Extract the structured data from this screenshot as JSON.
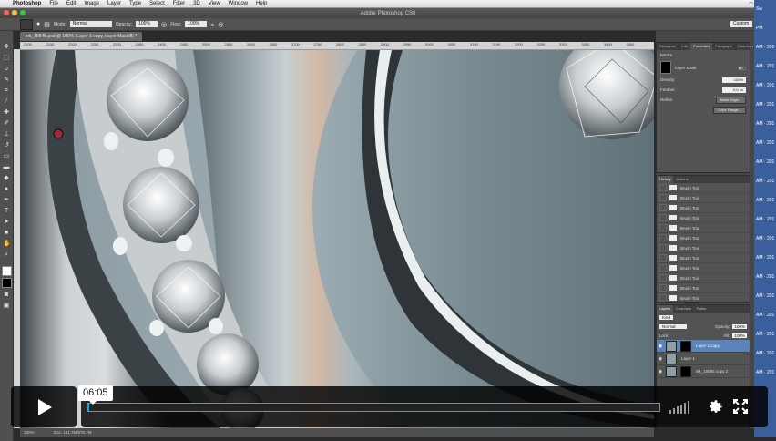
{
  "mac_menubar": {
    "items": [
      "Photoshop",
      "File",
      "Edit",
      "Image",
      "Layer",
      "Type",
      "Select",
      "Filter",
      "3D",
      "View",
      "Window",
      "Help"
    ]
  },
  "ps_window": {
    "title": "Adobe Photoshop CS6",
    "doc_tab": "ink_15845.psd @ 100% (Layer 1 copy, Layer Mask/8) *"
  },
  "options_bar": {
    "mode_label": "Mode:",
    "mode_value": "Normal",
    "opacity_label": "Opacity:",
    "opacity_value": "100%",
    "flow_label": "Flow:",
    "flow_value": "100%",
    "workspace_value": "Custom"
  },
  "ruler_ticks": [
    "2100",
    "2150",
    "2200",
    "2250",
    "2300",
    "2350",
    "2400",
    "2450",
    "2500",
    "2550",
    "2600",
    "2650",
    "2700",
    "2750",
    "2800",
    "2850",
    "2900",
    "2950",
    "3000",
    "3050",
    "3100",
    "3150",
    "3200",
    "3250",
    "3300",
    "3350",
    "3400",
    "3450"
  ],
  "properties_panel": {
    "tabs": [
      "Histogram",
      "Info",
      "Properties",
      "Paragraph",
      "Character"
    ],
    "header": "Masks",
    "mask_label": "Layer Mask",
    "density_label": "Density:",
    "density_value": "100%",
    "feather_label": "Feather:",
    "feather_value": "0.0 px",
    "refine_label": "Refine:",
    "mask_edge_button": "Mask Edge...",
    "color_range_button": "Color Range..."
  },
  "history_panel": {
    "tabs": [
      "History",
      "Actions"
    ],
    "items": [
      "Brush Tool",
      "Brush Tool",
      "Brush Tool",
      "Brush Tool",
      "Brush Tool",
      "Brush Tool",
      "Brush Tool",
      "Brush Tool",
      "Brush Tool",
      "Brush Tool",
      "Brush Tool",
      "Brush Tool",
      "Brush Tool"
    ]
  },
  "layers_panel": {
    "tabs": [
      "Layers",
      "Channels",
      "Paths"
    ],
    "kind_label": "Kind",
    "blend_value": "Normal",
    "opacity_label": "Opacity:",
    "opacity_value": "100%",
    "lock_label": "Lock:",
    "fill_label": "Fill:",
    "fill_value": "100%",
    "layers": [
      {
        "name": "Layer 1 copy",
        "selected": true,
        "has_mask": true
      },
      {
        "name": "Layer 1",
        "selected": false,
        "has_mask": false
      },
      {
        "name": "ink_15594 copy 2",
        "selected": false,
        "has_mask": true
      }
    ]
  },
  "status_bar": {
    "zoom": "100%",
    "doc_info": "Doc: 131.7M/575.7M"
  },
  "dock_strip": {
    "entries": [
      "Sw",
      "PM",
      "AM · 201",
      "AM · 201",
      "AM · 201",
      "AM · 201",
      "AM · 201",
      "AM · 201",
      "AM · 201",
      "AM · 201",
      "AM · 201",
      "AM · 201",
      "AM · 201",
      "AM · 201",
      "AM · 201",
      "AM · 201",
      "AM · 201",
      "AM · 201",
      "AM · 201",
      "AM · 201"
    ]
  },
  "player": {
    "time": "06:05",
    "progress": 0.003,
    "accent": "#00adef"
  },
  "icons": {
    "play": "play-icon",
    "volume": "volume-bars-icon",
    "settings": "gear-icon",
    "fullscreen": "fullscreen-icon"
  }
}
